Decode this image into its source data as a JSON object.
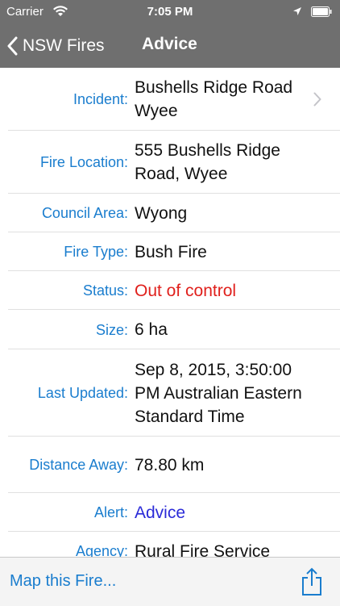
{
  "status_bar": {
    "carrier": "Carrier",
    "time": "7:05 PM",
    "icons": [
      "wifi-icon",
      "location-arrow-icon",
      "battery-icon"
    ]
  },
  "nav": {
    "back_label": "NSW Fires",
    "title": "Advice"
  },
  "details": [
    {
      "label": "Incident:",
      "value": "Bushells Ridge Road Wyee"
    },
    {
      "label": "Fire Location:",
      "value": "555 Bushells Ridge Road, Wyee"
    },
    {
      "label": "Council Area:",
      "value": "Wyong"
    },
    {
      "label": "Fire Type:",
      "value": "Bush Fire"
    },
    {
      "label": "Status:",
      "value": "Out of control"
    },
    {
      "label": "Size:",
      "value": "6 ha"
    },
    {
      "label": "Last Updated:",
      "value": "Sep 8, 2015, 3:50:00 PM Australian Eastern Standard Time"
    },
    {
      "label": "Distance Away:",
      "value": "78.80 km"
    },
    {
      "label": "Alert:",
      "value": "Advice"
    },
    {
      "label": "Agency:",
      "value": "Rural Fire Service"
    }
  ],
  "toolbar": {
    "map_label": "Map this Fire..."
  },
  "colors": {
    "bar_gray": "#6f6f6f",
    "label_blue": "#1a7dce",
    "status_red": "#e0201c",
    "alert_blue": "#2b2bd8"
  }
}
